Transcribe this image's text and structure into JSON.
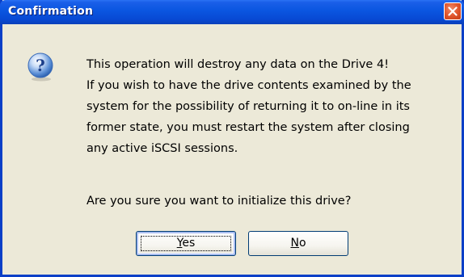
{
  "window": {
    "title": "Confirmation"
  },
  "dialog": {
    "icon": "question-icon",
    "message_lines": [
      "This operation will destroy any data on the Drive 4!",
      "If you wish to have the drive contents examined by the",
      "system for the possibility of returning it to on-line in its",
      "former state, you must restart the system after closing",
      "any active iSCSI sessions."
    ],
    "question": "Are you sure you want to initialize this drive?"
  },
  "buttons": {
    "yes": {
      "accel": "Y",
      "rest": "es"
    },
    "no": {
      "accel": "N",
      "rest": "o"
    }
  },
  "colors": {
    "titlebar": "#0a55e0",
    "close": "#e0552c",
    "dialog_bg": "#ece9d8"
  }
}
